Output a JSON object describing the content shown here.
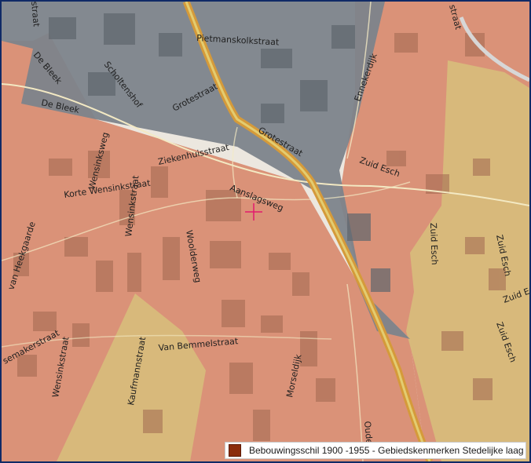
{
  "map": {
    "streets": [
      "Pietmanskolkstraat",
      "De Bleek",
      "De Bleek",
      "Scholtenshof",
      "Grotestraat",
      "Grotestraat",
      "Ennekerdijk",
      "Ziekenhuisstraat",
      "Zuid Esch",
      "Wensinksweg",
      "Korte Wensinkstraat",
      "Aanslagsweg",
      "Wensinkstraat",
      "Woolderweg",
      "van Heekgaarde",
      "Zuid Esch",
      "Zuid Esch",
      "Zuid Esch",
      "Zuid Esch",
      "semakerstraat",
      "Wensinkstraat",
      "Kaufmannstraat",
      "Van Bemmelstraat",
      "Morseldijk",
      "Oude",
      "straat",
      "straat"
    ],
    "overlay_colors": {
      "built_1900_1955": "#d98d72",
      "gray_zone": "#7d848b",
      "yellow_zone": "#d5b779",
      "main_road": "#e0a53a"
    },
    "crosshair_icon": "crosshair-marker"
  },
  "legend": {
    "swatch_color": "#8b2d0c",
    "label": "Bebouwingsschil 1900 -1955 - Gebiedskenmerken Stedelijke laag"
  }
}
